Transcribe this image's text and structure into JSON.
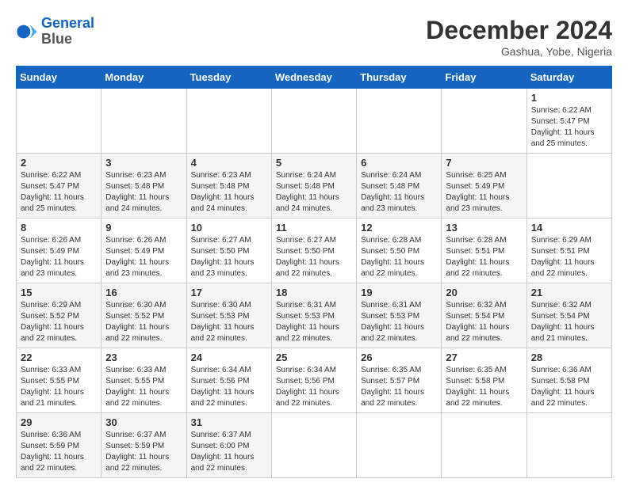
{
  "header": {
    "logo_line1": "General",
    "logo_line2": "Blue",
    "month_title": "December 2024",
    "location": "Gashua, Yobe, Nigeria"
  },
  "calendar": {
    "days_of_week": [
      "Sunday",
      "Monday",
      "Tuesday",
      "Wednesday",
      "Thursday",
      "Friday",
      "Saturday"
    ],
    "weeks": [
      [
        {
          "day": "",
          "info": ""
        },
        {
          "day": "",
          "info": ""
        },
        {
          "day": "",
          "info": ""
        },
        {
          "day": "",
          "info": ""
        },
        {
          "day": "",
          "info": ""
        },
        {
          "day": "",
          "info": ""
        },
        {
          "day": "1",
          "info": "Sunrise: 6:22 AM\nSunset: 5:47 PM\nDaylight: 11 hours\nand 25 minutes."
        }
      ],
      [
        {
          "day": "2",
          "info": "Sunrise: 6:22 AM\nSunset: 5:47 PM\nDaylight: 11 hours\nand 25 minutes."
        },
        {
          "day": "3",
          "info": "Sunrise: 6:23 AM\nSunset: 5:48 PM\nDaylight: 11 hours\nand 24 minutes."
        },
        {
          "day": "4",
          "info": "Sunrise: 6:23 AM\nSunset: 5:48 PM\nDaylight: 11 hours\nand 24 minutes."
        },
        {
          "day": "5",
          "info": "Sunrise: 6:24 AM\nSunset: 5:48 PM\nDaylight: 11 hours\nand 24 minutes."
        },
        {
          "day": "6",
          "info": "Sunrise: 6:24 AM\nSunset: 5:48 PM\nDaylight: 11 hours\nand 23 minutes."
        },
        {
          "day": "7",
          "info": "Sunrise: 6:25 AM\nSunset: 5:49 PM\nDaylight: 11 hours\nand 23 minutes."
        },
        {
          "day": "",
          "info": ""
        }
      ],
      [
        {
          "day": "8",
          "info": "Sunrise: 6:26 AM\nSunset: 5:49 PM\nDaylight: 11 hours\nand 23 minutes."
        },
        {
          "day": "9",
          "info": "Sunrise: 6:26 AM\nSunset: 5:49 PM\nDaylight: 11 hours\nand 23 minutes."
        },
        {
          "day": "10",
          "info": "Sunrise: 6:27 AM\nSunset: 5:50 PM\nDaylight: 11 hours\nand 23 minutes."
        },
        {
          "day": "11",
          "info": "Sunrise: 6:27 AM\nSunset: 5:50 PM\nDaylight: 11 hours\nand 22 minutes."
        },
        {
          "day": "12",
          "info": "Sunrise: 6:28 AM\nSunset: 5:50 PM\nDaylight: 11 hours\nand 22 minutes."
        },
        {
          "day": "13",
          "info": "Sunrise: 6:28 AM\nSunset: 5:51 PM\nDaylight: 11 hours\nand 22 minutes."
        },
        {
          "day": "14",
          "info": "Sunrise: 6:29 AM\nSunset: 5:51 PM\nDaylight: 11 hours\nand 22 minutes."
        }
      ],
      [
        {
          "day": "15",
          "info": "Sunrise: 6:29 AM\nSunset: 5:52 PM\nDaylight: 11 hours\nand 22 minutes."
        },
        {
          "day": "16",
          "info": "Sunrise: 6:30 AM\nSunset: 5:52 PM\nDaylight: 11 hours\nand 22 minutes."
        },
        {
          "day": "17",
          "info": "Sunrise: 6:30 AM\nSunset: 5:53 PM\nDaylight: 11 hours\nand 22 minutes."
        },
        {
          "day": "18",
          "info": "Sunrise: 6:31 AM\nSunset: 5:53 PM\nDaylight: 11 hours\nand 22 minutes."
        },
        {
          "day": "19",
          "info": "Sunrise: 6:31 AM\nSunset: 5:53 PM\nDaylight: 11 hours\nand 22 minutes."
        },
        {
          "day": "20",
          "info": "Sunrise: 6:32 AM\nSunset: 5:54 PM\nDaylight: 11 hours\nand 22 minutes."
        },
        {
          "day": "21",
          "info": "Sunrise: 6:32 AM\nSunset: 5:54 PM\nDaylight: 11 hours\nand 21 minutes."
        }
      ],
      [
        {
          "day": "22",
          "info": "Sunrise: 6:33 AM\nSunset: 5:55 PM\nDaylight: 11 hours\nand 21 minutes."
        },
        {
          "day": "23",
          "info": "Sunrise: 6:33 AM\nSunset: 5:55 PM\nDaylight: 11 hours\nand 22 minutes."
        },
        {
          "day": "24",
          "info": "Sunrise: 6:34 AM\nSunset: 5:56 PM\nDaylight: 11 hours\nand 22 minutes."
        },
        {
          "day": "25",
          "info": "Sunrise: 6:34 AM\nSunset: 5:56 PM\nDaylight: 11 hours\nand 22 minutes."
        },
        {
          "day": "26",
          "info": "Sunrise: 6:35 AM\nSunset: 5:57 PM\nDaylight: 11 hours\nand 22 minutes."
        },
        {
          "day": "27",
          "info": "Sunrise: 6:35 AM\nSunset: 5:58 PM\nDaylight: 11 hours\nand 22 minutes."
        },
        {
          "day": "28",
          "info": "Sunrise: 6:36 AM\nSunset: 5:58 PM\nDaylight: 11 hours\nand 22 minutes."
        }
      ],
      [
        {
          "day": "29",
          "info": "Sunrise: 6:36 AM\nSunset: 5:59 PM\nDaylight: 11 hours\nand 22 minutes."
        },
        {
          "day": "30",
          "info": "Sunrise: 6:37 AM\nSunset: 5:59 PM\nDaylight: 11 hours\nand 22 minutes."
        },
        {
          "day": "31",
          "info": "Sunrise: 6:37 AM\nSunset: 6:00 PM\nDaylight: 11 hours\nand 22 minutes."
        },
        {
          "day": "",
          "info": ""
        },
        {
          "day": "",
          "info": ""
        },
        {
          "day": "",
          "info": ""
        },
        {
          "day": "",
          "info": ""
        }
      ]
    ]
  }
}
